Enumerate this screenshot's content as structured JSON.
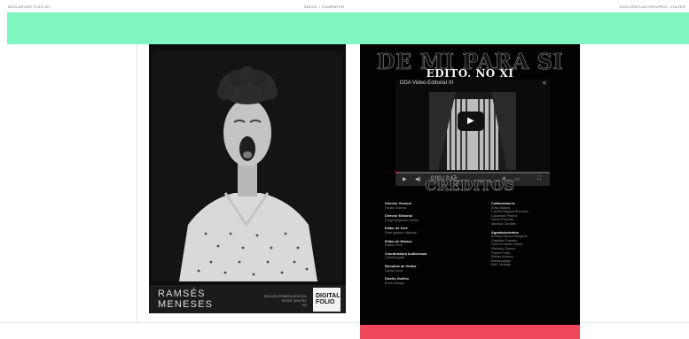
{
  "topbar": {
    "left": "DESCARGAR PLAYLIST",
    "center": "ÍNDICE + COMPARTIR",
    "right": "EDICIONES ANTERIORES / VOLVER"
  },
  "colors": {
    "teal": "#7ff5bf",
    "red": "#f0485b",
    "dark": "#020202"
  },
  "cover": {
    "name_line1": "RAMSÉS",
    "name_line2": "MENESES",
    "caption_lines": [
      "EDICIÓN PRIMERA EDICIÓN",
      "DESDE DENTRO",
      "XIII"
    ],
    "logo_text": [
      "DIGITAL",
      "FOLIO"
    ]
  },
  "magazine": {
    "title": "DE MI PARA SI",
    "subtitle": "EDITO. NO XI",
    "video": {
      "title": "DDA Video-Editorial XI",
      "time": "0:00 / 3:47",
      "progress": 0.02
    },
    "credits_title": "CRÉDITOS",
    "credits_left": [
      {
        "role": "Director General",
        "people": [
          "Fausto Garcia"
        ]
      },
      {
        "role": "Director Editorial",
        "people": [
          "Diego Alejandro Galas"
        ]
      },
      {
        "role": "Editor de Cine",
        "people": [
          "Ram Ignacio Villarrial"
        ]
      },
      {
        "role": "Editor de Música",
        "people": [
          "Rafael Ruiz"
        ]
      },
      {
        "role": "Coordinadora Audiovisual",
        "people": [
          "Camila Ayala"
        ]
      },
      {
        "role": "Ejecutiva de Ventas",
        "people": [
          "Daniel Leira"
        ]
      },
      {
        "role": "Diseño Gráfico",
        "people": [
          "Buen Design"
        ]
      }
    ],
    "credits_right": [
      {
        "role": "Colaboradores",
        "people": [
          "Erika Batitas",
          "Camila Salgado Escobar",
          "Casandra Pedroz",
          "Diana Palomar",
          "Monika Corrales"
        ]
      },
      {
        "role": "Agradecimientos",
        "people": [
          "Andrea García Morgane",
          "Gabriela Fuentes",
          "Luis Fernando Prado",
          "Stefania Gómez",
          "Rubén Prats",
          "Stefan Montez",
          "Balcanadoge",
          "BHC Vintage"
        ]
      }
    ]
  }
}
